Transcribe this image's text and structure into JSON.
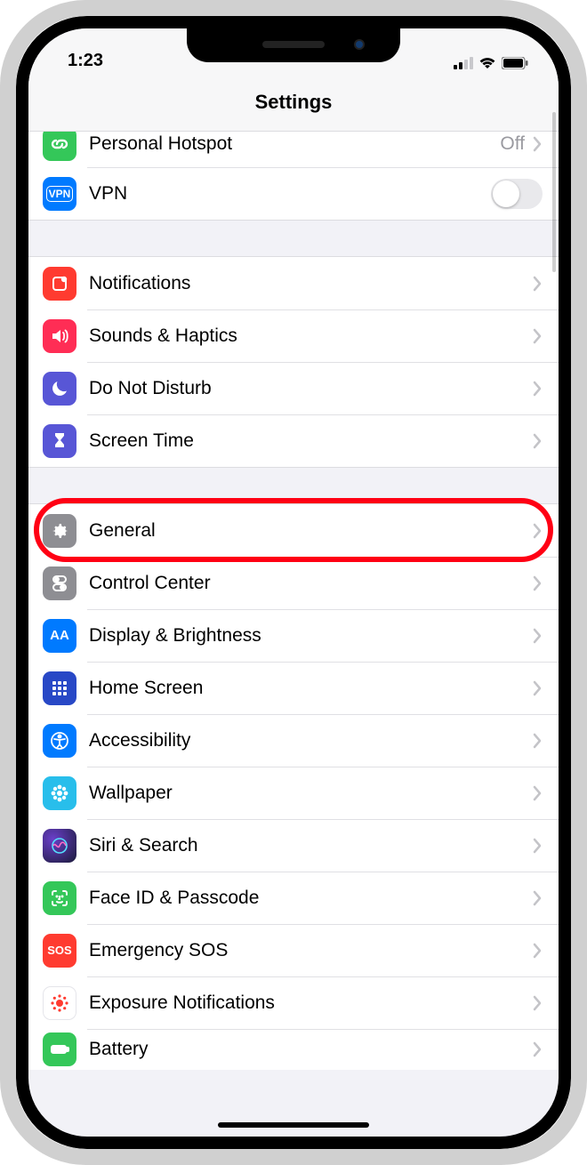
{
  "status": {
    "time": "1:23"
  },
  "navbar": {
    "title": "Settings"
  },
  "rows": {
    "hotspot": {
      "label": "Personal Hotspot",
      "detail": "Off",
      "icon_bg": "#34c759"
    },
    "vpn": {
      "label": "VPN",
      "icon_text": "VPN",
      "icon_bg": "#007aff"
    },
    "notifications": {
      "label": "Notifications",
      "icon_bg": "#ff3b30"
    },
    "sounds": {
      "label": "Sounds & Haptics",
      "icon_bg": "#ff2d55"
    },
    "dnd": {
      "label": "Do Not Disturb",
      "icon_bg": "#5856d6"
    },
    "screentime": {
      "label": "Screen Time",
      "icon_bg": "#5856d6"
    },
    "general": {
      "label": "General",
      "icon_bg": "#8e8e93"
    },
    "controlcenter": {
      "label": "Control Center",
      "icon_bg": "#8e8e93"
    },
    "display": {
      "label": "Display & Brightness",
      "icon_text": "AA",
      "icon_bg": "#007aff"
    },
    "homescreen": {
      "label": "Home Screen",
      "icon_bg": "#2848c6"
    },
    "accessibility": {
      "label": "Accessibility",
      "icon_bg": "#007aff"
    },
    "wallpaper": {
      "label": "Wallpaper",
      "icon_bg": "#28beeb"
    },
    "siri": {
      "label": "Siri & Search",
      "icon_bg": "#1a1a3a"
    },
    "faceid": {
      "label": "Face ID & Passcode",
      "icon_bg": "#34c759"
    },
    "sos": {
      "label": "Emergency SOS",
      "icon_text": "SOS",
      "icon_bg": "#ff3b30"
    },
    "exposure": {
      "label": "Exposure Notifications",
      "icon_bg": "#ffffff"
    },
    "battery": {
      "label": "Battery",
      "icon_bg": "#34c759"
    }
  },
  "highlight": {
    "target": "general"
  }
}
